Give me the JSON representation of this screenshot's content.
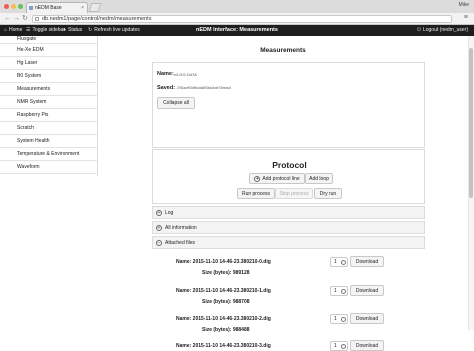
{
  "browser": {
    "tab_title": "nEDM Base",
    "url": "db.nedm1/page/control/nedm/measurements",
    "user": "Mike",
    "colors": {
      "close": "#ee5a52",
      "minimize": "#f5bd4f",
      "maximize": "#5fc453"
    }
  },
  "navbar": {
    "home": "Home",
    "toggle_sidebar": "Toggle sidebar",
    "status": "Status",
    "refresh": "Refresh live updates",
    "brand": "nEDM Interface: Measurements",
    "logout": "Logout (nedm_user)"
  },
  "sidebar": {
    "items": [
      {
        "label": "Fluxgate"
      },
      {
        "label": "He-Xe EDM"
      },
      {
        "label": "Hg Laser"
      },
      {
        "label": "B0 System"
      },
      {
        "label": "Measurements"
      },
      {
        "label": "NMR System"
      },
      {
        "label": "Raspberry Pis"
      },
      {
        "label": "Scratch"
      },
      {
        "label": "System Health"
      },
      {
        "label": "Temperature & Environment"
      },
      {
        "label": "Waveform"
      }
    ]
  },
  "main": {
    "page_title": "Measurements",
    "measurement": {
      "name_label": "Name:",
      "name_value": "c3-HG-DATA",
      "saved_label": "Saved:",
      "saved_value": "2f78ace93d9ba4a693ba1bde74beacd",
      "collapse_button": "Collapse all"
    },
    "protocol": {
      "title": "Protocol",
      "add_line": "Add protocol line",
      "add_loop": "Add loop",
      "run": "Run process",
      "stop": "Stop process",
      "dry_run": "Dry run"
    },
    "sections": {
      "log": "Log",
      "all_info": "All information",
      "attached": "Attached files"
    },
    "files": [
      {
        "name": "Name: 2015-11-10 14-46-23.380210-0.dig",
        "size": "Size (bytes): 989128",
        "qty": "1",
        "download": "Download"
      },
      {
        "name": "Name: 2015-11-10 14-46-23.380210-1.dig",
        "size": "Size (bytes): 988708",
        "qty": "1",
        "download": "Download"
      },
      {
        "name": "Name: 2015-11-10 14-46-23.380210-2.dig",
        "size": "Size (bytes): 988488",
        "qty": "1",
        "download": "Download"
      },
      {
        "name": "Name: 2015-11-10 14-46-23.380210-3.dig",
        "size": "",
        "qty": "1",
        "download": "Download"
      }
    ]
  }
}
